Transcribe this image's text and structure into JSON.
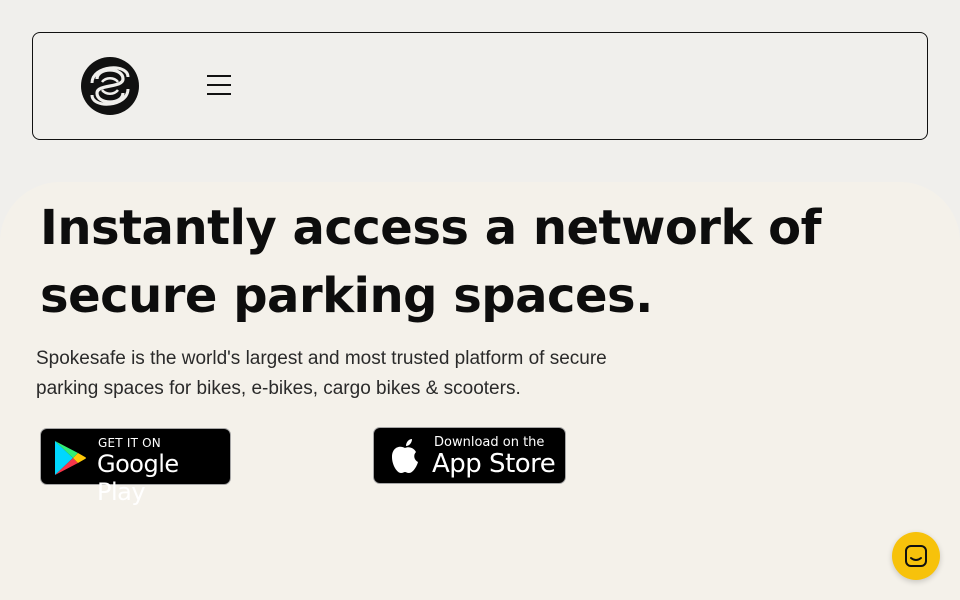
{
  "header": {
    "logo": "spokesafe-logo",
    "menu_icon": "hamburger-menu-icon"
  },
  "hero": {
    "headline_line1": "Instantly access a network of",
    "headline_line2": "secure parking spaces.",
    "description_line1": "Spokesafe is the world's largest and most trusted platform of secure",
    "description_line2": "parking spaces for bikes, e-bikes, cargo bikes & scooters."
  },
  "store_buttons": {
    "google_play": {
      "small": "GET IT ON",
      "big": "Google Play",
      "icon": "google-play-icon"
    },
    "app_store": {
      "small": "Download on the",
      "big": "App Store",
      "icon": "apple-icon"
    }
  },
  "chat": {
    "icon": "chat-icon",
    "color": "#f7c20b"
  }
}
